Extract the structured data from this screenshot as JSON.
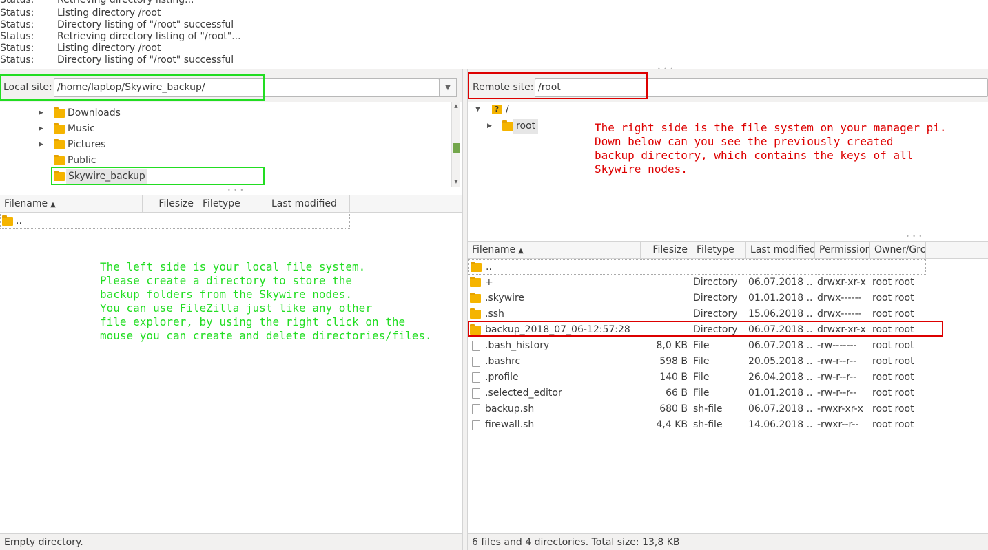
{
  "log": [
    {
      "label": "Status:",
      "message": "Retrieving directory listing..."
    },
    {
      "label": "Status:",
      "message": "Listing directory /root"
    },
    {
      "label": "Status:",
      "message": "Directory listing of \"/root\" successful"
    },
    {
      "label": "Status:",
      "message": "Retrieving directory listing of \"/root\"..."
    },
    {
      "label": "Status:",
      "message": "Listing directory /root"
    },
    {
      "label": "Status:",
      "message": "Directory listing of \"/root\" successful"
    }
  ],
  "local": {
    "site_label": "Local site:",
    "site_path": "/home/laptop/Skywire_backup/",
    "tree": [
      "Downloads",
      "Music",
      "Pictures",
      "Public",
      "Skywire_backup"
    ],
    "columns": [
      "Filename",
      "Filesize",
      "Filetype",
      "Last modified"
    ],
    "files": [
      ".."
    ],
    "status": "Empty directory."
  },
  "remote": {
    "site_label": "Remote site:",
    "site_path": "/root",
    "tree_root": "/",
    "tree_child": "root",
    "columns": [
      "Filename",
      "Filesize",
      "Filetype",
      "Last modified",
      "Permission",
      "Owner/Gro"
    ],
    "files": [
      {
        "name": "..",
        "size": "",
        "type": "",
        "modified": "",
        "perm": "",
        "owner": "",
        "kind": "folder"
      },
      {
        "name": "+",
        "size": "",
        "type": "Directory",
        "modified": "06.07.2018 ...",
        "perm": "drwxr-xr-x",
        "owner": "root root",
        "kind": "folder"
      },
      {
        "name": ".skywire",
        "size": "",
        "type": "Directory",
        "modified": "01.01.2018 ...",
        "perm": "drwx------",
        "owner": "root root",
        "kind": "folder"
      },
      {
        "name": ".ssh",
        "size": "",
        "type": "Directory",
        "modified": "15.06.2018 ...",
        "perm": "drwx------",
        "owner": "root root",
        "kind": "folder"
      },
      {
        "name": "backup_2018_07_06-12:57:28",
        "size": "",
        "type": "Directory",
        "modified": "06.07.2018 ...",
        "perm": "drwxr-xr-x",
        "owner": "root root",
        "kind": "folder"
      },
      {
        "name": ".bash_history",
        "size": "8,0 KB",
        "type": "File",
        "modified": "06.07.2018 ...",
        "perm": "-rw-------",
        "owner": "root root",
        "kind": "file"
      },
      {
        "name": ".bashrc",
        "size": "598 B",
        "type": "File",
        "modified": "20.05.2018 ...",
        "perm": "-rw-r--r--",
        "owner": "root root",
        "kind": "file"
      },
      {
        "name": ".profile",
        "size": "140 B",
        "type": "File",
        "modified": "26.04.2018 ...",
        "perm": "-rw-r--r--",
        "owner": "root root",
        "kind": "file"
      },
      {
        "name": ".selected_editor",
        "size": "66 B",
        "type": "File",
        "modified": "01.01.2018 ...",
        "perm": "-rw-r--r--",
        "owner": "root root",
        "kind": "file"
      },
      {
        "name": "backup.sh",
        "size": "680 B",
        "type": "sh-file",
        "modified": "06.07.2018 ...",
        "perm": "-rwxr-xr-x",
        "owner": "root root",
        "kind": "file"
      },
      {
        "name": "firewall.sh",
        "size": "4,4 KB",
        "type": "sh-file",
        "modified": "14.06.2018 ...",
        "perm": "-rwxr--r--",
        "owner": "root root",
        "kind": "file"
      }
    ],
    "status": "6 files and 4 directories. Total size: 13,8 KB"
  },
  "annotations": {
    "left_text": "The left side is your local file system.\nPlease create a directory to store the\nbackup folders from the Skywire nodes.\nYou can use FileZilla just like any other\nfile explorer, by using the right click on the\nmouse you can create and delete directories/files.",
    "right_text": "The right side is the file system on your manager pi.\nDown below can you see the previously created\nbackup directory, which contains the keys of all\nSkywire nodes.",
    "left_color": "#22dd22",
    "right_color": "#dd0000"
  },
  "colors": {
    "folder": "#f5b400",
    "scroll_thumb": "#73a64b"
  }
}
